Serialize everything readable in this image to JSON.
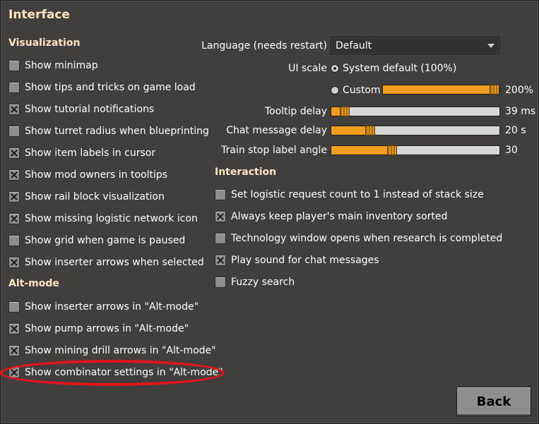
{
  "window": {
    "title": "Interface"
  },
  "visualization": {
    "heading": "Visualization",
    "items": [
      {
        "label": "Show minimap",
        "checked": false
      },
      {
        "label": "Show tips and tricks on game load",
        "checked": false
      },
      {
        "label": "Show tutorial notifications",
        "checked": true
      },
      {
        "label": "Show turret radius when blueprinting",
        "checked": false
      },
      {
        "label": "Show item labels in cursor",
        "checked": true
      },
      {
        "label": "Show mod owners in tooltips",
        "checked": true
      },
      {
        "label": "Show rail block visualization",
        "checked": true
      },
      {
        "label": "Show missing logistic network icon",
        "checked": true
      },
      {
        "label": "Show grid when game is paused",
        "checked": false
      },
      {
        "label": "Show inserter arrows when selected",
        "checked": true
      }
    ]
  },
  "altmode": {
    "heading": "Alt-mode",
    "items": [
      {
        "label": "Show inserter arrows in \"Alt-mode\"",
        "checked": false
      },
      {
        "label": "Show pump arrows in \"Alt-mode\"",
        "checked": true
      },
      {
        "label": "Show mining drill arrows in \"Alt-mode\"",
        "checked": true
      },
      {
        "label": "Show combinator settings in \"Alt-mode\"",
        "checked": true
      }
    ]
  },
  "language": {
    "label": "Language (needs restart)",
    "value": "Default"
  },
  "ui_scale": {
    "label": "UI scale",
    "system_default_label": "System default (100%)",
    "custom_label": "Custom",
    "selected": "system_default",
    "custom_value_text": "200%",
    "custom_fraction": 1.0
  },
  "sliders": [
    {
      "label": "Tooltip delay",
      "value_text": "39 ms",
      "fraction": 0.05
    },
    {
      "label": "Chat message delay",
      "value_text": "20 s",
      "fraction": 0.2
    },
    {
      "label": "Train stop label angle",
      "value_text": "30",
      "fraction": 0.33
    }
  ],
  "interaction": {
    "heading": "Interaction",
    "items": [
      {
        "label": "Set logistic request count to 1 instead of stack size",
        "checked": false
      },
      {
        "label": "Always keep player's main inventory sorted",
        "checked": true
      },
      {
        "label": "Technology window opens when research is completed",
        "checked": false
      },
      {
        "label": "Play sound for chat messages",
        "checked": true
      },
      {
        "label": "Fuzzy search",
        "checked": false
      }
    ]
  },
  "buttons": {
    "back": "Back"
  },
  "colors": {
    "accent": "#f19e1e",
    "highlight": "#e3141a",
    "heading": "#ffe6c0"
  }
}
